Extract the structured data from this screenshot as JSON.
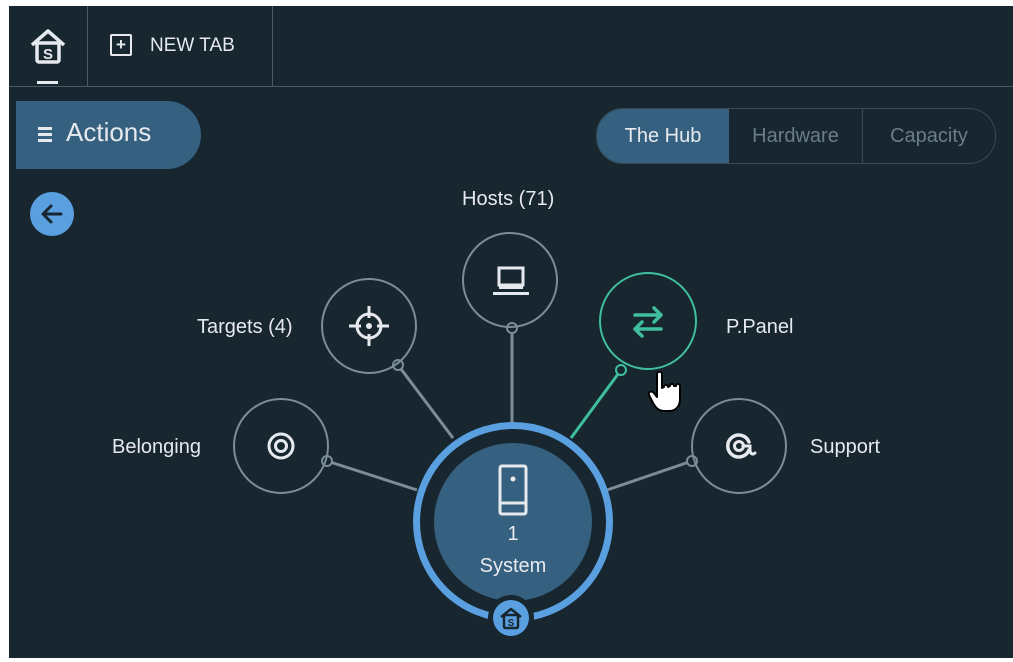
{
  "tabs": {
    "home_icon": "home-s-icon",
    "new_tab_label": "NEW TAB"
  },
  "actions": {
    "label": "Actions",
    "icon": "hamburger-icon"
  },
  "view_switch": {
    "options": [
      "The Hub",
      "Hardware",
      "Capacity"
    ],
    "selected": "The Hub"
  },
  "back": {
    "icon": "arrow-left-icon"
  },
  "hub": {
    "center": {
      "count": "1",
      "label": "System",
      "icon": "server-icon",
      "badge_icon": "home-s-icon"
    },
    "nodes": {
      "hosts": {
        "label": "Hosts (71)",
        "icon": "monitor-icon"
      },
      "targets": {
        "label": "Targets (4)",
        "icon": "crosshair-icon"
      },
      "ppanel": {
        "label": "P.Panel",
        "icon": "swap-arrows-icon"
      },
      "belonging": {
        "label": "Belonging",
        "icon": "target-rings-icon"
      },
      "support": {
        "label": "Support",
        "icon": "at-sign-icon"
      }
    }
  },
  "colors": {
    "background": "#17262f",
    "accent_blue": "#5aa0e0",
    "panel_blue": "#36607f",
    "active_teal": "#3fbfa0",
    "node_border": "#7b8d98"
  }
}
